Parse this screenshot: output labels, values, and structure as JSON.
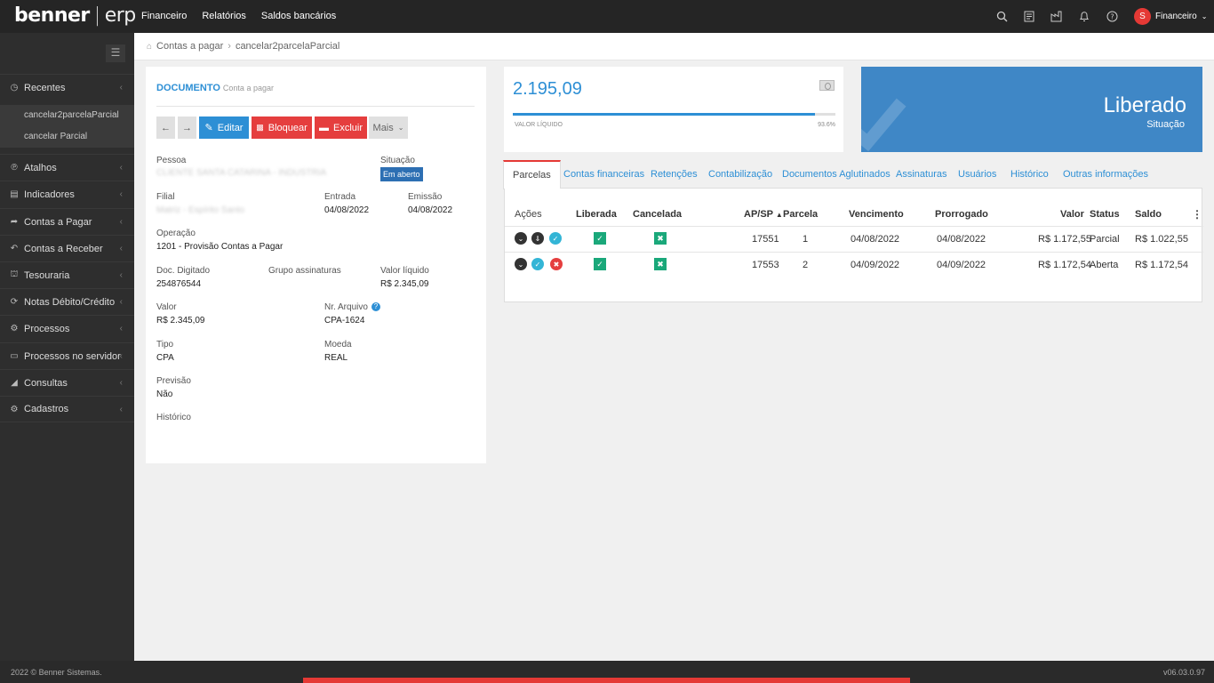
{
  "brand": {
    "name": "benner",
    "product": "erp"
  },
  "topnav": [
    "Financeiro",
    "Relatórios",
    "Saldos bancários"
  ],
  "topicons": [
    "search-icon",
    "report-icon",
    "factory-icon",
    "bell-icon",
    "help-icon"
  ],
  "user": {
    "initial": "S",
    "label": "Financeiro"
  },
  "sidebar": {
    "recentes_label": "Recentes",
    "recent_items": [
      "cancelar2parcelaParcial",
      "cancelar Parcial"
    ],
    "items": [
      {
        "label": "Atalhos",
        "icon": "shortcut-icon"
      },
      {
        "label": "Indicadores",
        "icon": "chart-icon"
      },
      {
        "label": "Contas a Pagar",
        "icon": "share-icon"
      },
      {
        "label": "Contas a Receber",
        "icon": "reply-icon"
      },
      {
        "label": "Tesouraria",
        "icon": "bank-icon"
      },
      {
        "label": "Notas Débito/Crédito",
        "icon": "refresh-icon"
      },
      {
        "label": "Processos",
        "icon": "cogs-icon"
      },
      {
        "label": "Processos no servidor",
        "icon": "laptop-icon"
      },
      {
        "label": "Consultas",
        "icon": "binoculars-icon"
      },
      {
        "label": "Cadastros",
        "icon": "gear-icon"
      }
    ]
  },
  "breadcrumb": {
    "root": "Contas a pagar",
    "current": "cancelar2parcelaParcial"
  },
  "document": {
    "title": "DOCUMENTO",
    "subtitle": "Conta a pagar",
    "buttons": {
      "edit": "Editar",
      "block": "Bloquear",
      "delete": "Excluir",
      "more": "Mais"
    },
    "fields": {
      "pessoa_label": "Pessoa",
      "pessoa_value": "CLIENTE SANTA CATARINA - INDUSTRIA",
      "situacao_label": "Situação",
      "situacao_value": "Em aberto",
      "filial_label": "Filial",
      "filial_value": "Matriz - Espírito Santo",
      "entrada_label": "Entrada",
      "entrada_value": "04/08/2022",
      "emissao_label": "Emissão",
      "emissao_value": "04/08/2022",
      "operacao_label": "Operação",
      "operacao_value": "1201 - Provisão Contas a Pagar",
      "doc_label": "Doc. Digitado",
      "doc_value": "254876544",
      "grupo_label": "Grupo assinaturas",
      "vliq_label": "Valor líquido",
      "vliq_value": "R$ 2.345,09",
      "valor_label": "Valor",
      "valor_value": "R$ 2.345,09",
      "arquivo_label": "Nr. Arquivo",
      "arquivo_value": "CPA-1624",
      "tipo_label": "Tipo",
      "tipo_value": "CPA",
      "moeda_label": "Moeda",
      "moeda_value": "REAL",
      "previsao_label": "Previsão",
      "previsao_value": "Não",
      "historico_label": "Histórico"
    }
  },
  "value_card": {
    "value": "2.195,09",
    "label": "VALOR LÍQUIDO",
    "percent_text": "93.6%",
    "progress": 0.936
  },
  "status_card": {
    "title": "Liberado",
    "subtitle": "Situação"
  },
  "tabs": [
    "Parcelas",
    "Contas financeiras",
    "Retenções",
    "Contabilização",
    "Documentos Aglutinados",
    "Assinaturas",
    "Usuários",
    "Histórico",
    "Outras informações"
  ],
  "table": {
    "headers": {
      "acoes": "Ações",
      "liberada": "Liberada",
      "cancelada": "Cancelada",
      "apsp": "AP/SP",
      "parcela": "Parcela",
      "vencimento": "Vencimento",
      "prorrogado": "Prorrogado",
      "valor": "Valor",
      "status": "Status",
      "saldo": "Saldo"
    },
    "rows": [
      {
        "apsp": "17551",
        "parcela": "1",
        "vencimento": "04/08/2022",
        "prorrogado": "04/08/2022",
        "valor": "R$ 1.172,55",
        "status": "Parcial",
        "saldo": "R$ 1.022,55"
      },
      {
        "apsp": "17553",
        "parcela": "2",
        "vencimento": "04/09/2022",
        "prorrogado": "04/09/2022",
        "valor": "R$ 1.172,54",
        "status": "Aberta",
        "saldo": "R$ 1.172,54"
      }
    ]
  },
  "footer": {
    "copyright": "2022 © Benner Sistemas.",
    "version": "v06.03.0.97"
  },
  "colors": {
    "accent": "#2d8fd5",
    "danger": "#e53e3e",
    "success": "#1aa87a",
    "status_card": "#3f87c6"
  }
}
